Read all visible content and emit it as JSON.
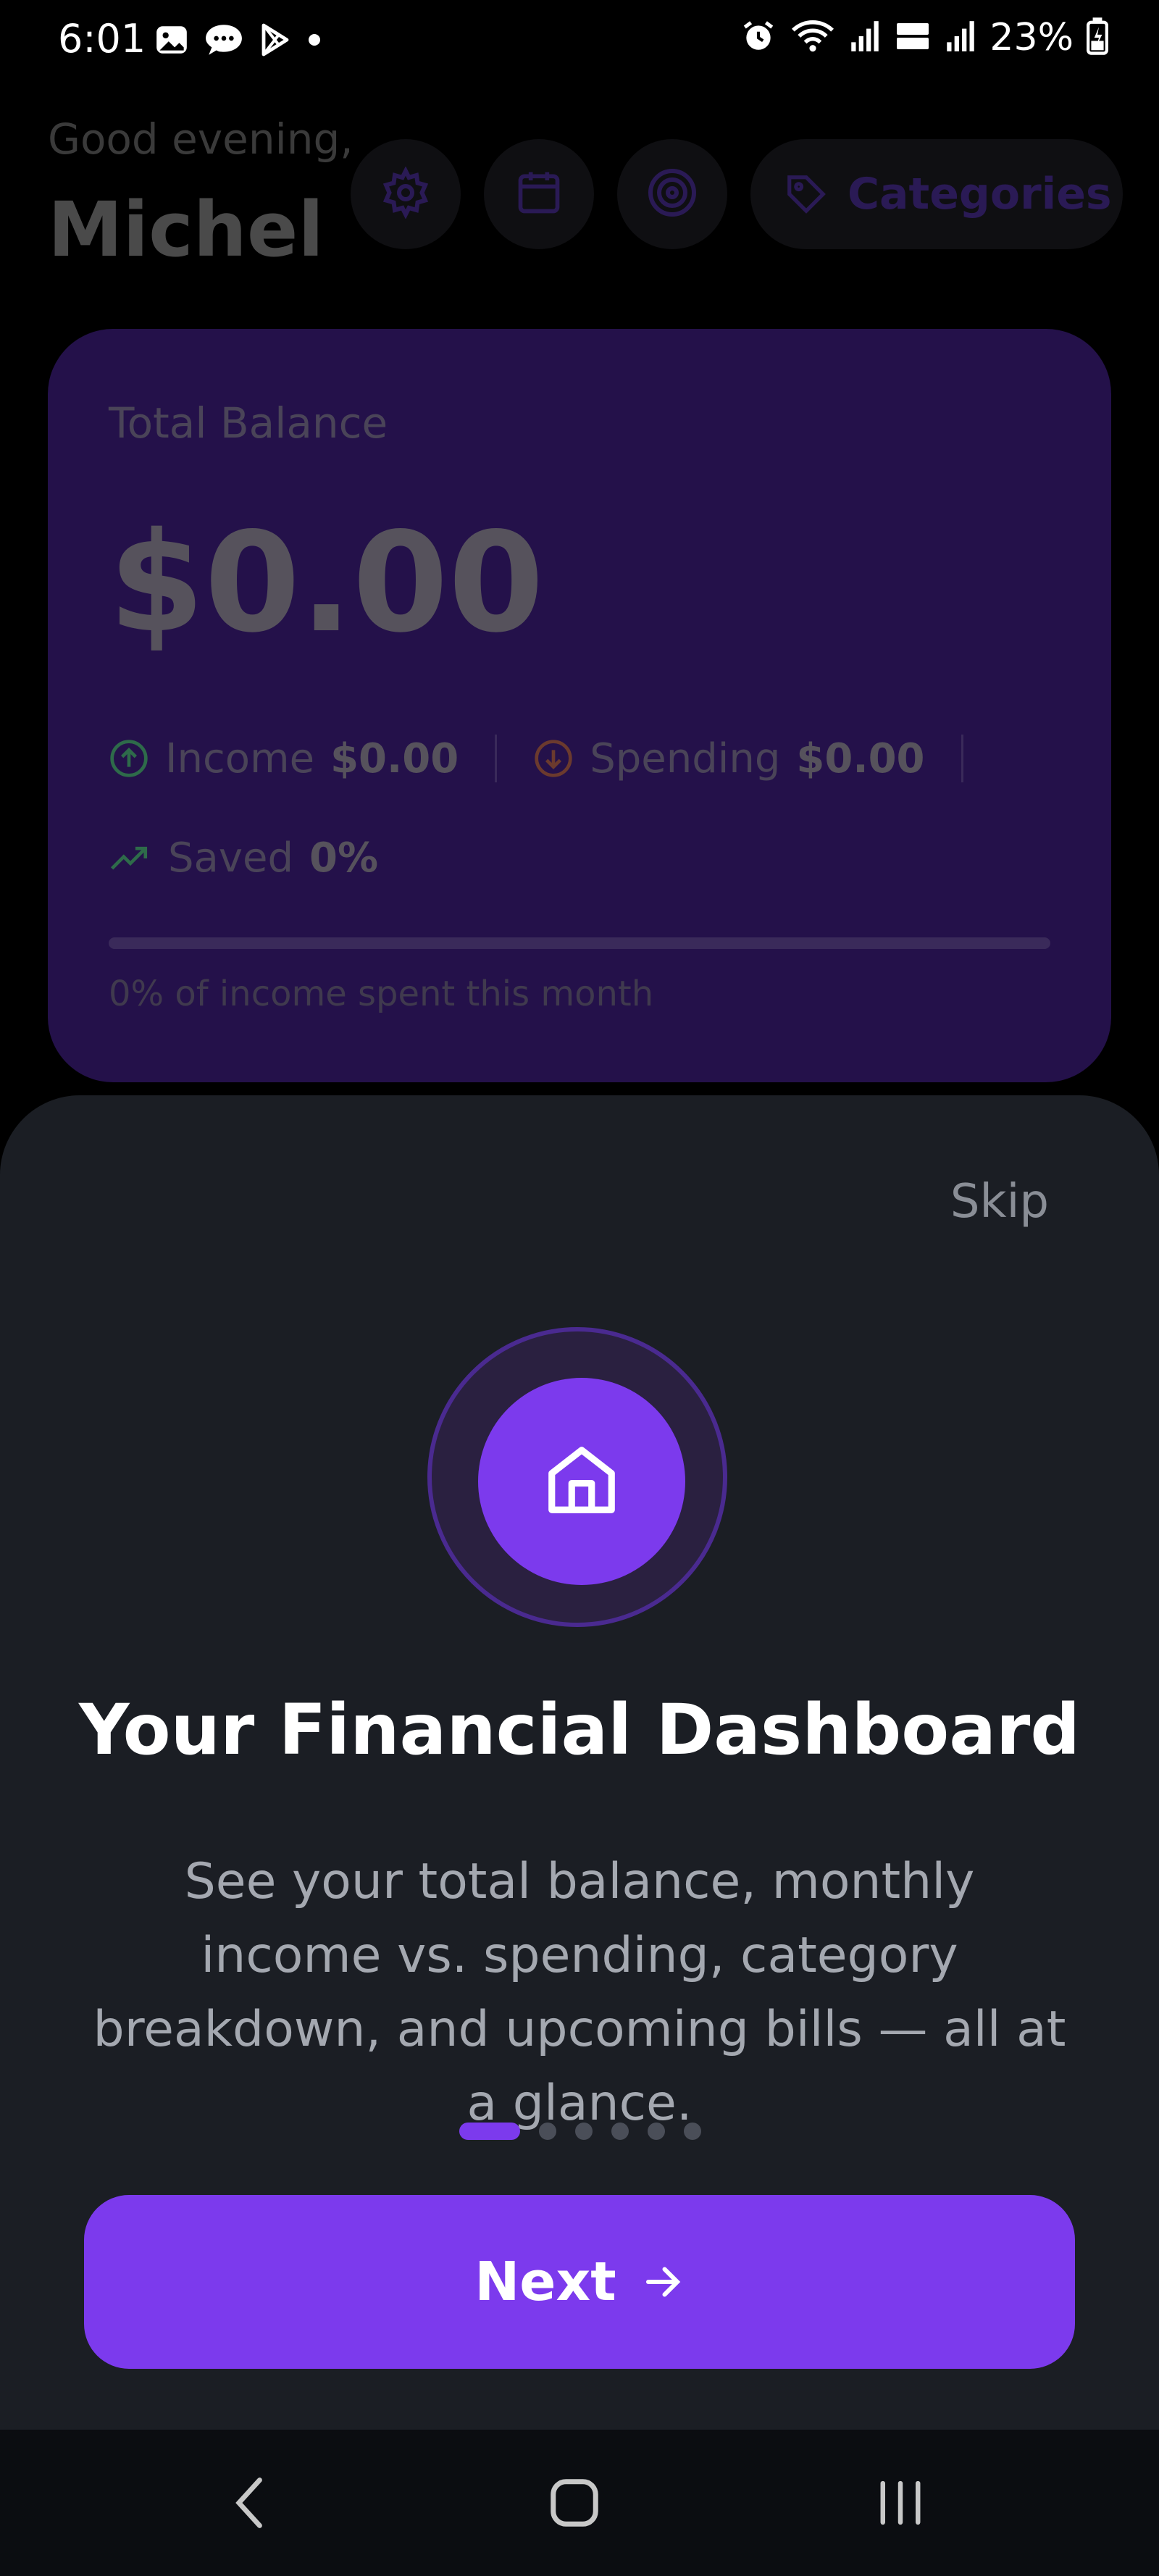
{
  "status_bar": {
    "time": "6:01",
    "battery": "23%",
    "icons": [
      "image-icon",
      "chat-icon",
      "play-store-icon",
      "dot-icon",
      "alarm-icon",
      "wifi-icon",
      "signal-icon",
      "volte-icon",
      "signal-icon-2",
      "battery-icon"
    ]
  },
  "header": {
    "greeting": "Good evening,",
    "name": "Michel",
    "categories_label": "Categories"
  },
  "balance_card": {
    "label": "Total Balance",
    "amount": "$0.00",
    "income_label": "Income",
    "income_value": "$0.00",
    "spending_label": "Spending",
    "spending_value": "$0.00",
    "saved_label": "Saved",
    "saved_value": "0%",
    "spent_progress": 0,
    "note": "0% of income spent this month"
  },
  "onboarding": {
    "skip": "Skip",
    "title": "Your Financial Dashboard",
    "description": "See your total balance, monthly income vs. spending, category breakdown, and upcoming bills — all at a glance.",
    "page_count": 6,
    "current_page": 1,
    "next_label": "Next"
  },
  "colors": {
    "accent": "#7c3aed",
    "sheet_bg": "#1b1e24",
    "card_bg": "#24114a"
  }
}
